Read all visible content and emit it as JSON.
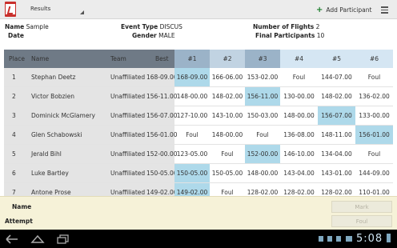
{
  "actionbar": {
    "spinner_label": "Results",
    "add_participant_label": "Add Participant"
  },
  "info": {
    "name_label": "Name",
    "name_value": "Sample",
    "date_label": "Date",
    "event_type_label": "Event Type",
    "event_type_value": "DISCUS",
    "gender_label": "Gender",
    "gender_value": "MALE",
    "flights_label": "Number of Flights",
    "flights_value": "2",
    "finals_label": "Final Participants",
    "finals_value": "10"
  },
  "table": {
    "headers": [
      "Place",
      "Name",
      "Team",
      "Best",
      "#1",
      "#2",
      "#3",
      "#4",
      "#5",
      "#6"
    ],
    "rows": [
      {
        "place": "1",
        "name": "Stephan Deetz",
        "team": "Unaffiliated",
        "best": "168-09.00",
        "a": [
          "168-09.00",
          "166-06.00",
          "153-02.00",
          "Foul",
          "144-07.00",
          "Foul"
        ],
        "hl": 0
      },
      {
        "place": "2",
        "name": "Victor Bobzien",
        "team": "Unaffiliated",
        "best": "156-11.00",
        "a": [
          "148-00.00",
          "148-02.00",
          "156-11.00",
          "130-00.00",
          "148-02.00",
          "136-02.00"
        ],
        "hl": 2
      },
      {
        "place": "3",
        "name": "Dominick McGlamery",
        "team": "Unaffiliated",
        "best": "156-07.00",
        "a": [
          "127-10.00",
          "143-10.00",
          "150-03.00",
          "148-00.00",
          "156-07.00",
          "133-00.00"
        ],
        "hl": 4
      },
      {
        "place": "4",
        "name": "Glen Schabowski",
        "team": "Unaffiliated",
        "best": "156-01.00",
        "a": [
          "Foul",
          "148-00.00",
          "Foul",
          "136-08.00",
          "148-11.00",
          "156-01.00"
        ],
        "hl": 5
      },
      {
        "place": "5",
        "name": "Jerald Bihl",
        "team": "Unaffiliated",
        "best": "152-00.00",
        "a": [
          "123-05.00",
          "Foul",
          "152-00.00",
          "146-10.00",
          "134-04.00",
          "Foul"
        ],
        "hl": 2
      },
      {
        "place": "6",
        "name": "Luke Bartley",
        "team": "Unaffiliated",
        "best": "150-05.00",
        "a": [
          "150-05.00",
          "150-05.00",
          "148-00.00",
          "143-04.00",
          "143-01.00",
          "144-09.00"
        ],
        "hl": 0
      },
      {
        "place": "7",
        "name": "Antone Prose",
        "team": "Unaffiliated",
        "best": "149-02.00",
        "a": [
          "149-02.00",
          "Foul",
          "128-02.00",
          "128-02.00",
          "128-02.00",
          "110-01.00"
        ],
        "hl": 0
      }
    ]
  },
  "panel": {
    "name_label": "Name",
    "attempt_label": "Attempt",
    "mark_button": "Mark",
    "foul_button": "Foul"
  },
  "sysbar": {
    "clock": "5:08"
  },
  "colors": {
    "highlight": "#aed9ea",
    "header_dark": "#6f7a86",
    "header_mid": "#9bb3c8",
    "header_light": "#d5e6f3",
    "panel_bg": "#f6f2d8"
  },
  "icons": [
    "app-logo-icon",
    "spinner-arrow-icon",
    "add-icon",
    "overflow-menu-icon",
    "back-icon",
    "home-icon",
    "recent-apps-icon"
  ]
}
